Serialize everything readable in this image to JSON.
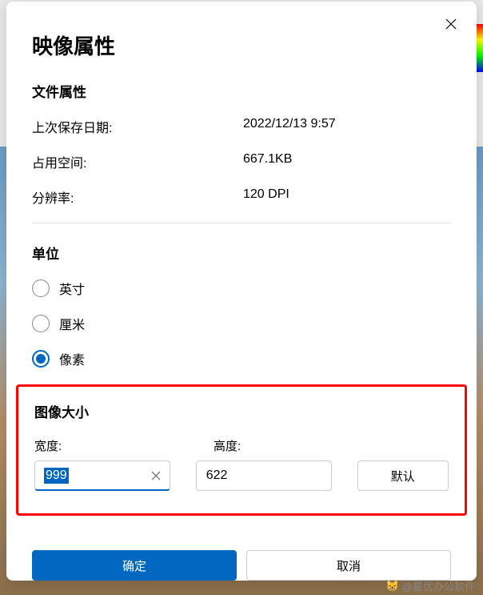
{
  "dialog": {
    "title": "映像属性",
    "file_props_heading": "文件属性",
    "rows": {
      "last_saved_label": "上次保存日期:",
      "last_saved_value": "2022/12/13 9:57",
      "size_label": "占用空间:",
      "size_value": "667.1KB",
      "resolution_label": "分辨率:",
      "resolution_value": "120 DPI"
    },
    "units": {
      "heading": "单位",
      "inches": "英寸",
      "cm": "厘米",
      "pixels": "像素"
    },
    "image_size": {
      "heading": "图像大小",
      "width_label": "宽度:",
      "height_label": "高度:",
      "width_value": "999",
      "height_value": "622",
      "default_btn": "默认"
    },
    "ok": "确定",
    "cancel": "取消"
  },
  "watermark": "@星优办公软件"
}
